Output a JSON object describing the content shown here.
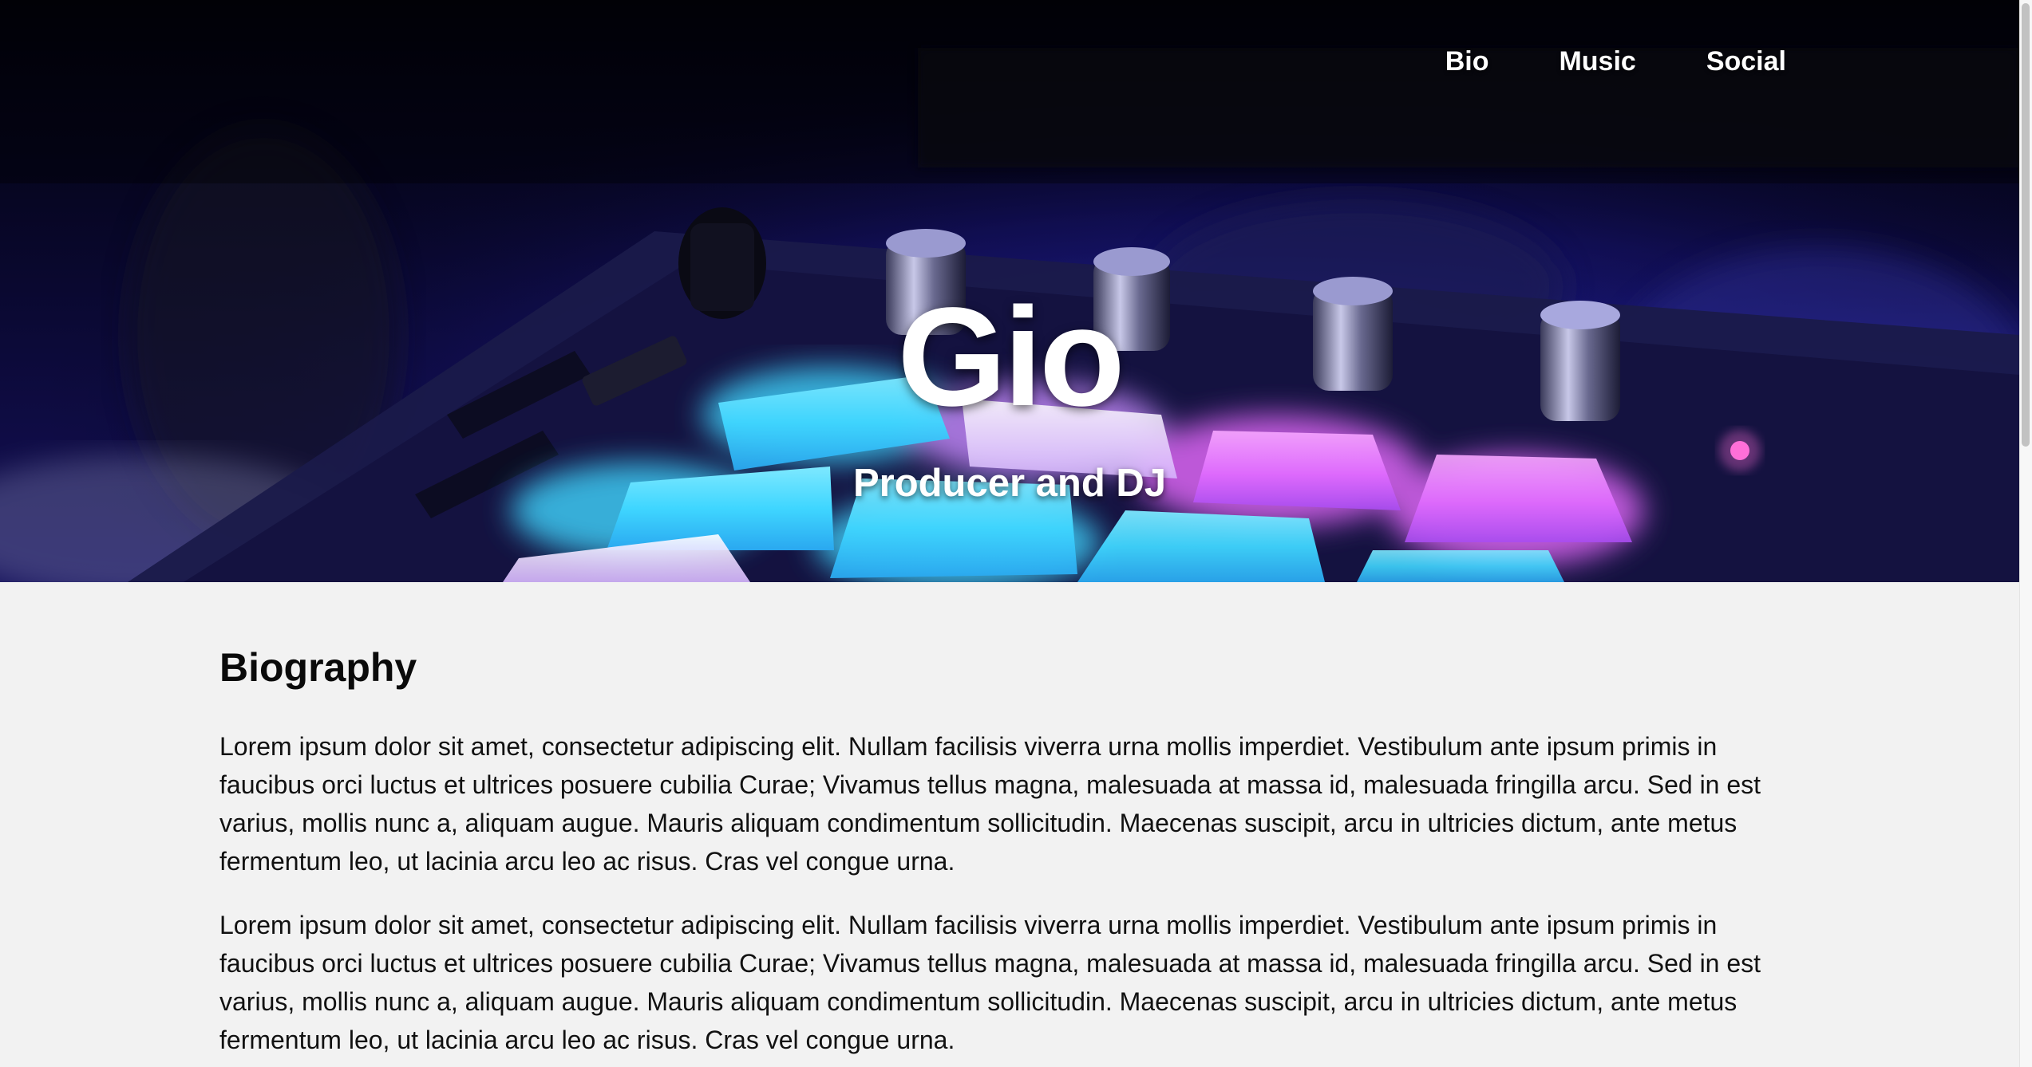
{
  "nav": {
    "items": [
      {
        "label": "Bio"
      },
      {
        "label": "Music"
      },
      {
        "label": "Social"
      }
    ]
  },
  "hero": {
    "title": "Gio",
    "subtitle": "Producer and DJ",
    "background": "dj-controller-photo"
  },
  "bio": {
    "heading": "Biography",
    "paragraphs": [
      "Lorem ipsum dolor sit amet, consectetur adipiscing elit. Nullam facilisis viverra urna mollis imperdiet. Vestibulum ante ipsum primis in faucibus orci luctus et ultrices posuere cubilia Curae; Vivamus tellus magna, malesuada at massa id, malesuada fringilla arcu. Sed in est varius, mollis nunc a, aliquam augue. Mauris aliquam condimentum sollicitudin. Maecenas suscipit, arcu in ultricies dictum, ante metus fermentum leo, ut lacinia arcu leo ac risus. Cras vel congue urna.",
      "Lorem ipsum dolor sit amet, consectetur adipiscing elit. Nullam facilisis viverra urna mollis imperdiet. Vestibulum ante ipsum primis in faucibus orci luctus et ultrices posuere cubilia Curae; Vivamus tellus magna, malesuada at massa id, malesuada fringilla arcu. Sed in est varius, mollis nunc a, aliquam augue. Mauris aliquam condimentum sollicitudin. Maecenas suscipit, arcu in ultricies dictum, ante metus fermentum leo, ut lacinia arcu leo ac risus. Cras vel congue urna."
    ]
  },
  "colors": {
    "page_background": "#f2f2f2",
    "hero_dark": "#050418",
    "pad_cyan": "#3fd6ff",
    "pad_magenta": "#e86bff",
    "text": "#111111",
    "nav_text": "#ffffff"
  }
}
